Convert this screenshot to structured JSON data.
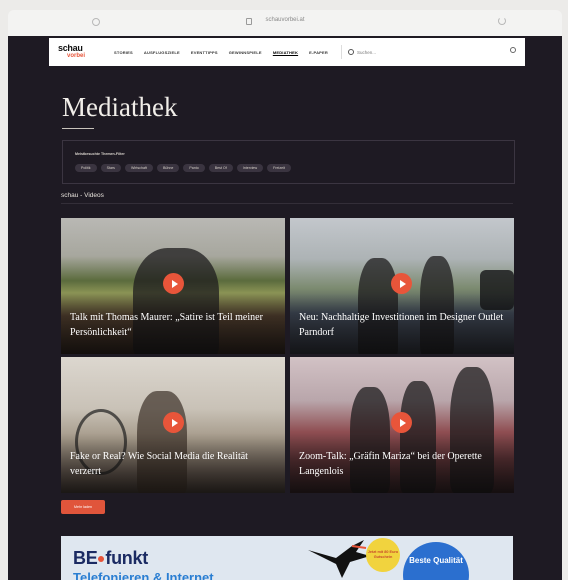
{
  "browser": {
    "url": "schauvorbei.at"
  },
  "nav": {
    "logo_top": "schau",
    "logo_bottom": "vorbei",
    "items": [
      "STORIES",
      "AUSFLUGSZIELE",
      "EVENTTIPPS",
      "GEWINNSPIELE",
      "MEDIATHEK",
      "E-PAPER"
    ],
    "active_item": "MEDIATHEK",
    "search_placeholder": "Suchen..."
  },
  "page": {
    "title": "Mediathek",
    "filter_heading": "Meistbesuchte Themen-Filter",
    "tags": [
      "Politik",
      "Stars",
      "Wirtschaft",
      "Bühne",
      "Panto",
      "Best Of",
      "Interview",
      "Freizeit"
    ],
    "section_label": "schau - Videos",
    "more_button": "Mehr laden"
  },
  "videos": [
    {
      "title": "Talk mit Thomas Maurer: „Satire ist Teil meiner Persönlichkeit“"
    },
    {
      "title": "Neu: Nachhaltige Investitionen im Designer Outlet Parndorf"
    },
    {
      "title": "Fake or Real? Wie Social Media die Realität verzerrt"
    },
    {
      "title": "Zoom-Talk: „Gräfin Mariza“ bei der Operette Langenlois"
    }
  ],
  "ad": {
    "brand_a": "BE",
    "brand_b": "funkt",
    "subline": "Telefonieren & Internet",
    "badge": "Jetzt mit 80 Euro Gutschein",
    "circle": "Beste Qualität"
  },
  "colors": {
    "page_bg": "#1e1a23",
    "accent": "#e8553a",
    "text_light": "#f1eee9"
  }
}
